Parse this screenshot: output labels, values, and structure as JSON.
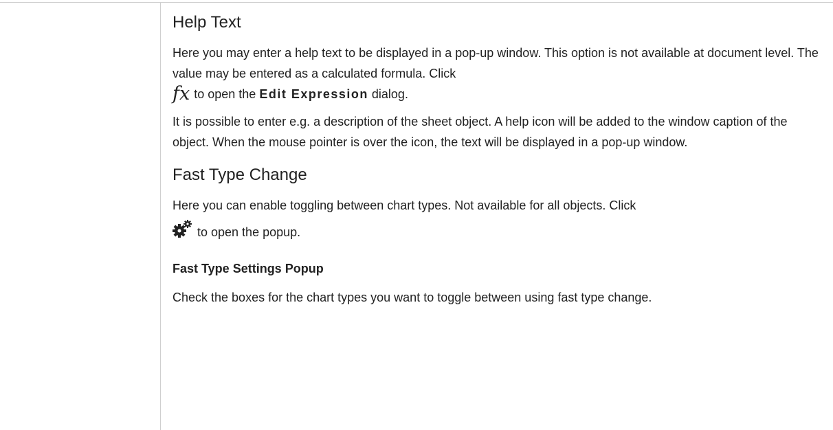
{
  "help_text": {
    "heading": "Help Text",
    "para1_a": "Here you may enter a help text to be displayed in a pop-up window. This option is not available at document level. The value may be entered as a calculated formula. Click",
    "fx_icon": "fx",
    "para1_b": "to open the",
    "edit_expression": "Edit Expression",
    "para1_c": "dialog.",
    "para2": "It is possible to enter e.g. a description of the sheet object. A help icon will be added to the window caption of the object. When the mouse pointer is over the icon, the text will be displayed in a pop-up window."
  },
  "fast_type": {
    "heading": "Fast Type Change",
    "para1": "Here you can enable toggling between chart types. Not available for all objects. Click",
    "icon": "gear-icon",
    "para1_b": "to open the popup.",
    "subheading": "Fast Type Settings Popup",
    "para2": "Check the boxes for the chart types you want to toggle between using fast type change."
  }
}
